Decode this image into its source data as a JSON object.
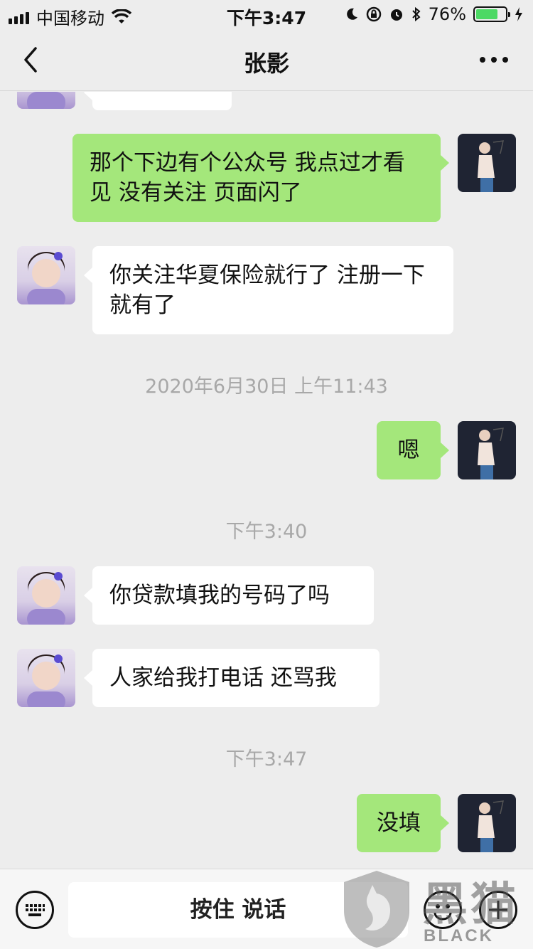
{
  "status_bar": {
    "carrier": "中国移动",
    "time": "下午3:47",
    "battery_percent": "76%",
    "battery_level": 0.76
  },
  "nav": {
    "title": "张影"
  },
  "messages": [
    {
      "from": "other",
      "text": ""
    },
    {
      "from": "me",
      "text": "那个下边有个公众号  我点过才看见  没有关注  页面闪了"
    },
    {
      "from": "other",
      "text": "你关注华夏保险就行了 注册一下 就有了"
    },
    {
      "from": "time",
      "text": "2020年6月30日 上午11:43"
    },
    {
      "from": "me",
      "text": "嗯"
    },
    {
      "from": "time",
      "text": "下午3:40"
    },
    {
      "from": "other",
      "text": "你贷款填我的号码了吗"
    },
    {
      "from": "other",
      "text": "人家给我打电话 还骂我"
    },
    {
      "from": "time",
      "text": "下午3:47"
    },
    {
      "from": "me",
      "text": "没填"
    }
  ],
  "input_bar": {
    "hold_to_talk_label": "按住 说话"
  },
  "watermark": {
    "cn": "黑猫",
    "en": "BLACK CAT"
  },
  "colors": {
    "background": "#ededed",
    "my_bubble": "#a4e77b",
    "other_bubble": "#ffffff",
    "battery_fill": "#4cd964"
  }
}
